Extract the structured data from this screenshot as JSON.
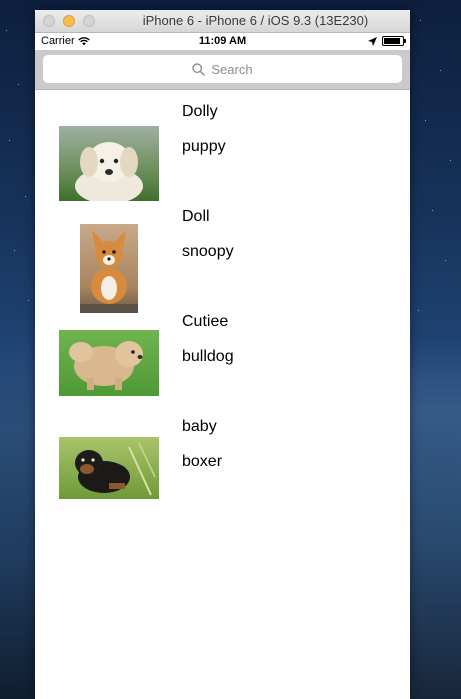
{
  "window": {
    "title": "iPhone 6 - iPhone 6 / iOS 9.3 (13E230)"
  },
  "status_bar": {
    "carrier": "Carrier",
    "time": "11:09 AM",
    "battery_level": 0.9
  },
  "search": {
    "placeholder": "Search"
  },
  "dogs": [
    {
      "name": "Dolly",
      "breed": "puppy",
      "icon": "white-puppy-photo"
    },
    {
      "name": "Doll",
      "breed": "snoopy",
      "icon": "corgi-puppy-photo"
    },
    {
      "name": "Cutiee",
      "breed": "bulldog",
      "icon": "chow-puppy-photo"
    },
    {
      "name": "baby",
      "breed": "boxer",
      "icon": "rottweiler-puppy-photo"
    }
  ],
  "colors": {
    "traffic_min": "#f5bf4f",
    "search_bar_bg": "#c9c9ce"
  }
}
